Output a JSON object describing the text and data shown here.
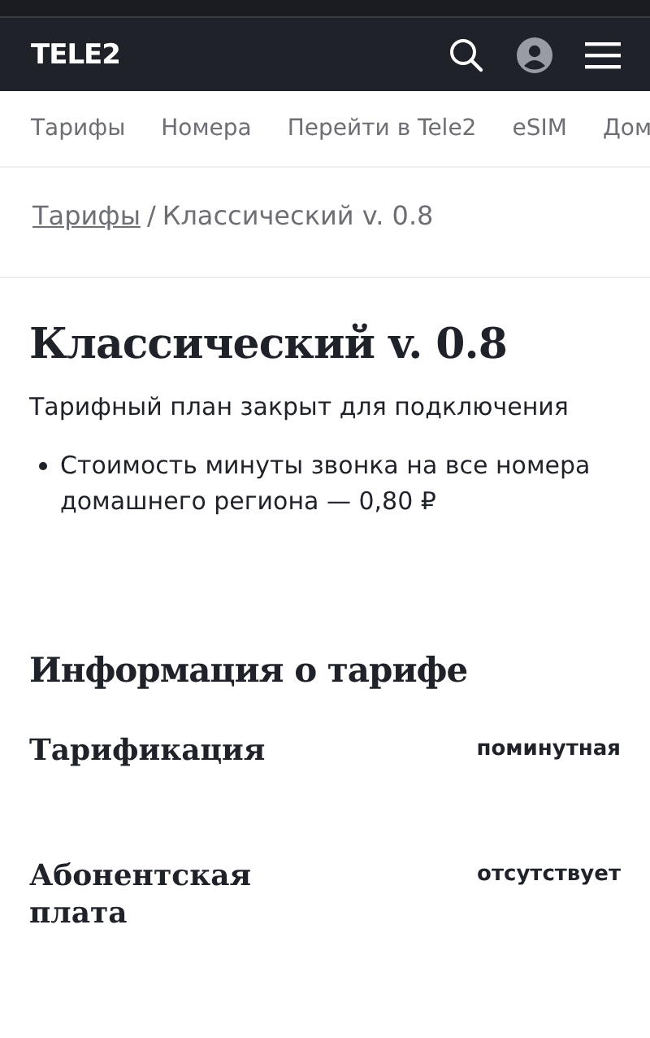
{
  "header": {
    "logo": "TELE2"
  },
  "nav": [
    {
      "label": "Тарифы"
    },
    {
      "label": "Номера"
    },
    {
      "label": "Перейти в Tele2"
    },
    {
      "label": "eSIM"
    },
    {
      "label": "Дом"
    }
  ],
  "breadcrumb": {
    "link": "Тарифы",
    "separator": "/",
    "current": "Классический v. 0.8"
  },
  "title": "Классический v. 0.8",
  "subtitle": "Тарифный план закрыт для подключения",
  "bullets": [
    "Стоимость минуты звонка на все номера домашнего региона — 0,80 ₽"
  ],
  "info": {
    "heading": "Информация о тарифе",
    "rows": [
      {
        "label": "Тарификация",
        "value": "поминутная"
      },
      {
        "label": "Абонентская плата",
        "value": "отсутствует"
      }
    ]
  }
}
